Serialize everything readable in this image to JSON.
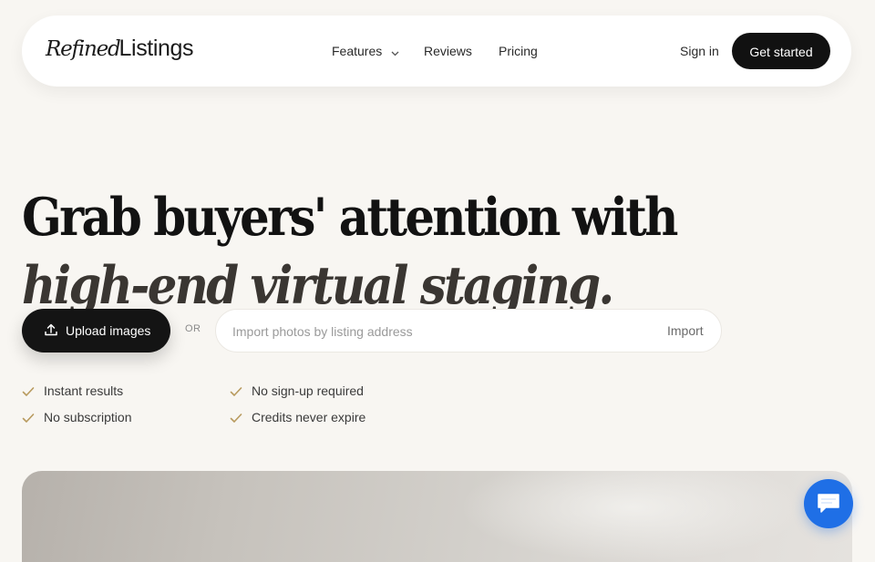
{
  "nav": {
    "brand_script": "Refined",
    "brand_word": "Listings",
    "links": [
      {
        "label": "Features"
      },
      {
        "label": "Reviews"
      },
      {
        "label": "Pricing"
      }
    ],
    "signin_label": "Sign in",
    "cta_label": "Get started"
  },
  "hero": {
    "line1": "Grab buyers' attention with",
    "line2": "high-end virtual staging."
  },
  "actions": {
    "upload_label": "Upload images",
    "or_label": "OR",
    "import_placeholder": "Import photos by listing address",
    "import_button": "Import"
  },
  "features": [
    {
      "label": "Instant results"
    },
    {
      "label": "No sign-up required"
    },
    {
      "label": "No subscription"
    },
    {
      "label": "Credits never expire"
    }
  ],
  "icons": {
    "chevron": "chevron-down-icon",
    "upload": "upload-icon",
    "check": "check-icon",
    "chat": "chat-icon"
  },
  "colors": {
    "background": "#f8f6f2",
    "primary_button": "#111111",
    "check_accent": "#b89a5e",
    "chat_fab": "#1f6fe6"
  }
}
